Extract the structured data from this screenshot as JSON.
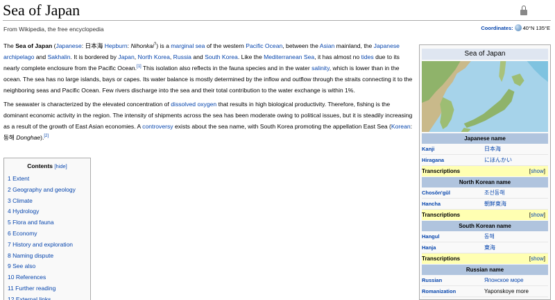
{
  "page": {
    "title": "Sea of Japan",
    "tagline": "From Wikipedia, the free encyclopedia",
    "coordinates_label": "Coordinates:",
    "coordinates_value": "40°N 135°E"
  },
  "icons": {
    "lock": "lock-icon",
    "globe": "globe-icon"
  },
  "colors": {
    "link": "#0645ad",
    "infobox_header": "#b0c4de",
    "transcriptions": "#ffffb2",
    "caption": "#dfe6f1"
  },
  "article": {
    "p1": [
      {
        "t": "The "
      },
      {
        "t": "Sea of Japan",
        "b": true
      },
      {
        "t": " ("
      },
      {
        "t": "Japanese",
        "a": true
      },
      {
        "t": ": 日本海 "
      },
      {
        "t": "Hepburn",
        "a": true
      },
      {
        "t": ": "
      },
      {
        "t": "Nihonkai",
        "i": true
      },
      {
        "t": "?",
        "sup": true
      },
      {
        "t": ") is a "
      },
      {
        "t": "marginal sea",
        "a": true
      },
      {
        "t": " of the western "
      },
      {
        "t": "Pacific Ocean",
        "a": true
      },
      {
        "t": ", between the "
      },
      {
        "t": "Asian",
        "a": true
      },
      {
        "t": " mainland, the "
      },
      {
        "t": "Japanese archipelago",
        "a": true
      },
      {
        "t": " and "
      },
      {
        "t": "Sakhalin",
        "a": true
      },
      {
        "t": ". It is bordered by "
      },
      {
        "t": "Japan",
        "a": true
      },
      {
        "t": ", "
      },
      {
        "t": "North Korea",
        "a": true
      },
      {
        "t": ", "
      },
      {
        "t": "Russia",
        "a": true
      },
      {
        "t": " and "
      },
      {
        "t": "South Korea",
        "a": true
      },
      {
        "t": ". Like the "
      },
      {
        "t": "Mediterranean Sea",
        "a": true
      },
      {
        "t": ", it has almost no "
      },
      {
        "t": "tides",
        "a": true
      },
      {
        "t": " due to its nearly complete enclosure from the Pacific Ocean."
      },
      {
        "t": "[1]",
        "sup": true,
        "a": true
      },
      {
        "t": " This isolation also reflects in the fauna species and in the water "
      },
      {
        "t": "salinity",
        "a": true
      },
      {
        "t": ", which is lower than in the ocean. The sea has no large islands, bays or capes. Its water balance is mostly determined by the inflow and outflow through the straits connecting it to the neighboring seas and Pacific Ocean. Few rivers discharge into the sea and their total contribution to the water exchange is within 1%."
      }
    ],
    "p2": [
      {
        "t": "The seawater is characterized by the elevated concentration of "
      },
      {
        "t": "dissolved oxygen",
        "a": true
      },
      {
        "t": " that results in high biological productivity. Therefore, fishing is the dominant economic activity in the region. The intensity of shipments across the sea has been moderate owing to political issues, but it is steadily increasing as a result of the growth of East Asian economies. A "
      },
      {
        "t": "controversy",
        "a": true
      },
      {
        "t": " exists about the sea name, with South Korea promoting the appellation East Sea ("
      },
      {
        "t": "Korean",
        "a": true
      },
      {
        "t": ": 동해 "
      },
      {
        "t": "Donghae",
        "i": true
      },
      {
        "t": ")."
      },
      {
        "t": "[2]",
        "sup": true,
        "a": true
      }
    ]
  },
  "toc": {
    "title": "Contents",
    "hide_label": "[hide]",
    "items": [
      "1 Extent",
      "2 Geography and geology",
      "3 Climate",
      "4 Hydrology",
      "5 Flora and fauna",
      "6 Economy",
      "7 History and exploration",
      "8 Naming dispute",
      "9 See also",
      "10 References",
      "11 Further reading",
      "12 External links"
    ]
  },
  "infobox": {
    "caption": "Sea of Japan",
    "transcriptions_label": "Transcriptions",
    "show_label": "show",
    "sections": [
      {
        "header": "Japanese name",
        "rows": [
          {
            "k": "Kanji",
            "v": "日本海"
          },
          {
            "k": "Hiragana",
            "v": "にほんかい"
          }
        ],
        "transcriptions": true
      },
      {
        "header": "North Korean name",
        "rows": [
          {
            "k": "Chosŏn'gŭl",
            "v": "조선동해"
          },
          {
            "k": "Hancha",
            "v": "朝鮮東海"
          }
        ],
        "transcriptions": true
      },
      {
        "header": "South Korean name",
        "rows": [
          {
            "k": "Hangul",
            "v": "동해"
          },
          {
            "k": "Hanja",
            "v": "東海"
          }
        ],
        "transcriptions": true
      },
      {
        "header": "Russian name",
        "rows": [
          {
            "k": "Russian",
            "v": "Японское море"
          },
          {
            "k": "Romanization",
            "v": "Yaponskoye more",
            "plain": true
          }
        ],
        "transcriptions": false
      }
    ]
  }
}
